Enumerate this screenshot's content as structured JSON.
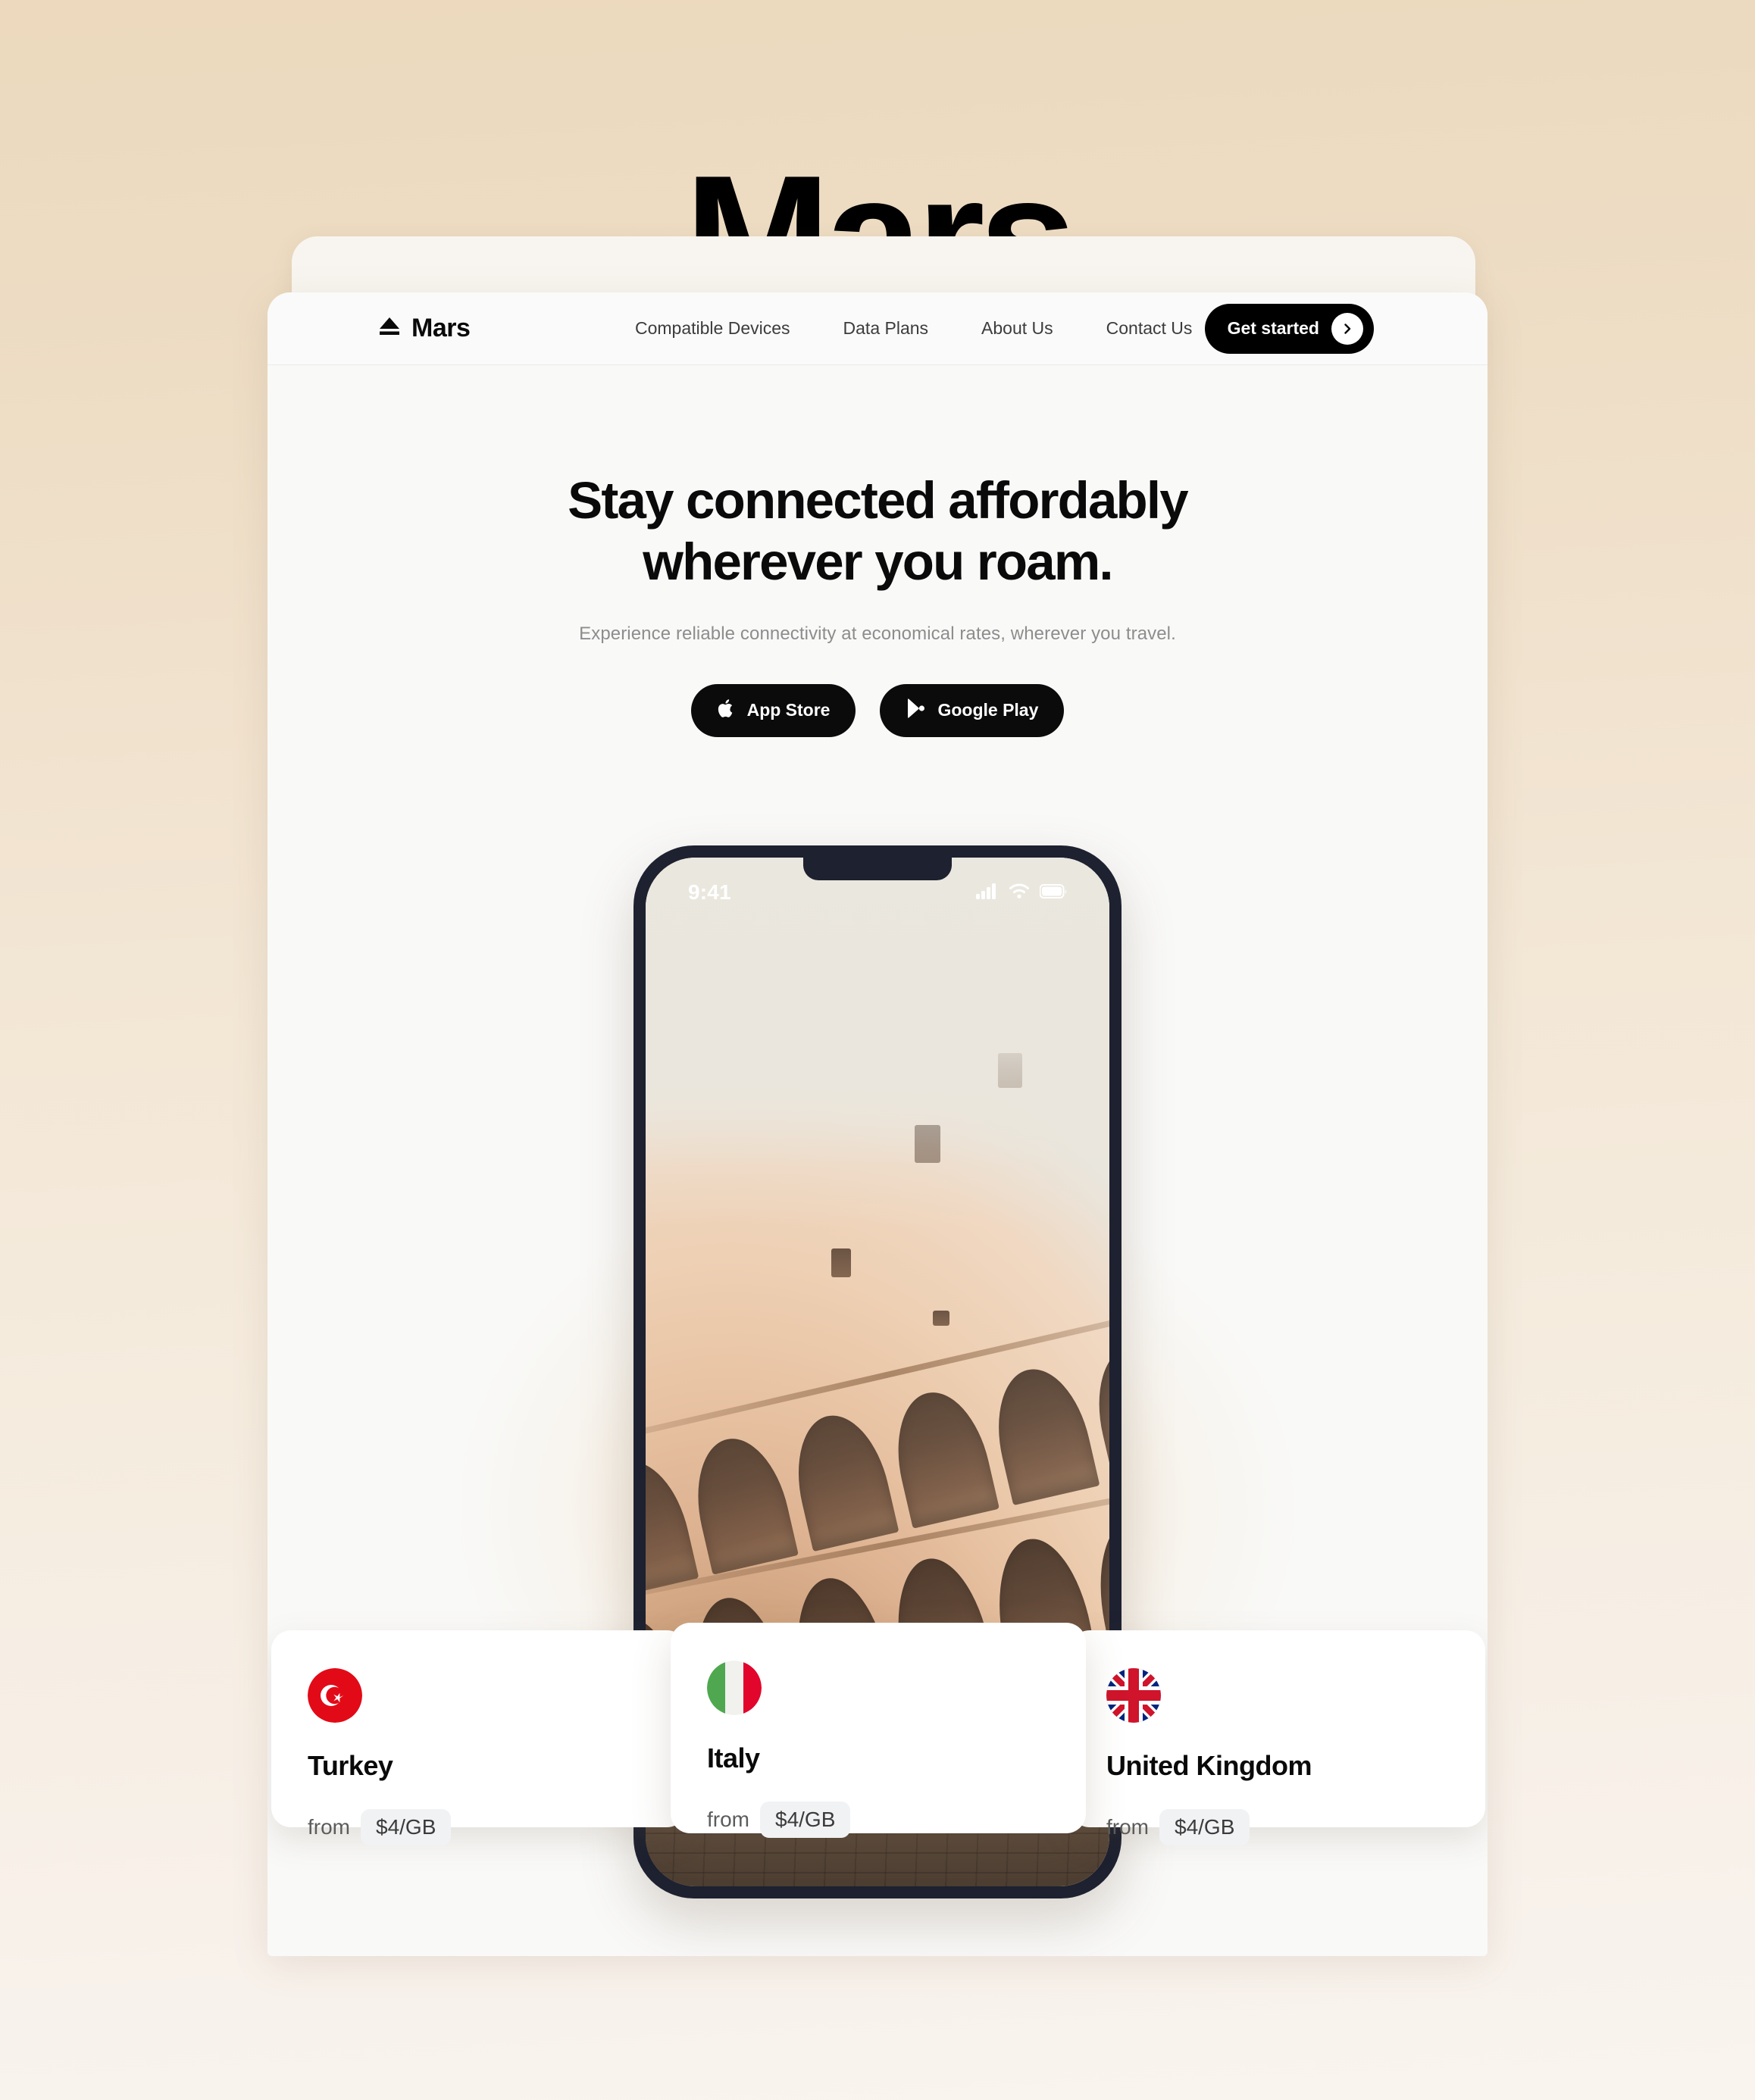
{
  "brand": {
    "name": "Mars",
    "wordmark": "Mars",
    "logo_icon": "eject-icon"
  },
  "nav": {
    "links": [
      {
        "label": "Compatible Devices"
      },
      {
        "label": "Data Plans"
      },
      {
        "label": "About Us"
      },
      {
        "label": "Contact Us"
      }
    ],
    "cta": {
      "label": "Get started",
      "icon": "chevron-right-icon"
    }
  },
  "hero": {
    "headline_line1": "Stay connected affordably",
    "headline_line2": "wherever you roam.",
    "subheadline": "Experience reliable connectivity at economical rates, wherever you travel.",
    "store_buttons": [
      {
        "label": "App Store",
        "icon": "apple-icon"
      },
      {
        "label": "Google Play",
        "icon": "google-play-icon"
      }
    ]
  },
  "phone": {
    "status_bar": {
      "time": "9:41",
      "icons": [
        "cellular-signal-icon",
        "wifi-icon",
        "battery-icon"
      ]
    },
    "wallpaper_alt": "Colosseum, Rome"
  },
  "cards": [
    {
      "country": "Turkey",
      "flag": "turkey-flag-icon",
      "from_label": "from",
      "price": "$4/GB"
    },
    {
      "country": "Italy",
      "flag": "italy-flag-icon",
      "from_label": "from",
      "price": "$4/GB"
    },
    {
      "country": "United Kingdom",
      "flag": "united-kingdom-flag-icon",
      "from_label": "from",
      "price": "$4/GB"
    }
  ],
  "colors": {
    "background_top": "#ecd9be",
    "background_bottom": "#f9f4ee",
    "window": "#f9f9f8",
    "accent_dark": "#000000",
    "phone_frame": "#1d2130",
    "turkey_red": "#e30a17",
    "italy_green": "#5aa council",
    "price_pill": "#f1f2f4"
  }
}
